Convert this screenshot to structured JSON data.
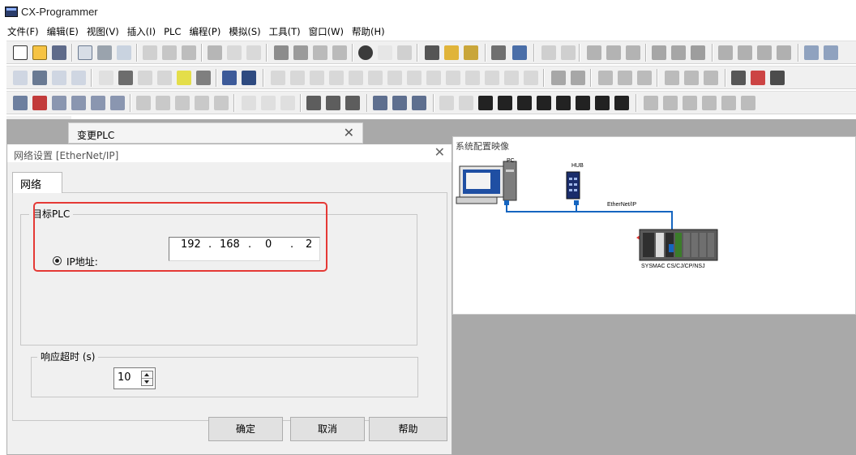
{
  "app": {
    "title": "CX-Programmer"
  },
  "menu": [
    "文件(F)",
    "编辑(E)",
    "视图(V)",
    "插入(I)",
    "PLC",
    "编程(P)",
    "模拟(S)",
    "工具(T)",
    "窗口(W)",
    "帮助(H)"
  ],
  "change_plc_dialog": {
    "title": "变更PLC",
    "close": "✕"
  },
  "network_dialog": {
    "title": "网络设置 [EtherNet/IP]",
    "close": "✕",
    "tab": "网络",
    "target_group_label": "目标PLC",
    "ip_label": "IP地址:",
    "ip_octets": [
      "192",
      "168",
      "0",
      "2"
    ],
    "ip_separator": ".",
    "timeout_group_label": "响应超时 (s)",
    "timeout_value": "10",
    "buttons": {
      "ok": "确定",
      "cancel": "取消",
      "help": "帮助"
    }
  },
  "system_config": {
    "title": "系统配置映像",
    "pc_label": "PC",
    "hub_label": "HUB",
    "network_label": "EtherNet/IP",
    "plc_label": "SYSMAC CS/CJ/CP/NSJ"
  },
  "colors": {
    "highlight": "#e53935",
    "network_line": "#1565c0",
    "workspace": "#a9a9a9"
  }
}
